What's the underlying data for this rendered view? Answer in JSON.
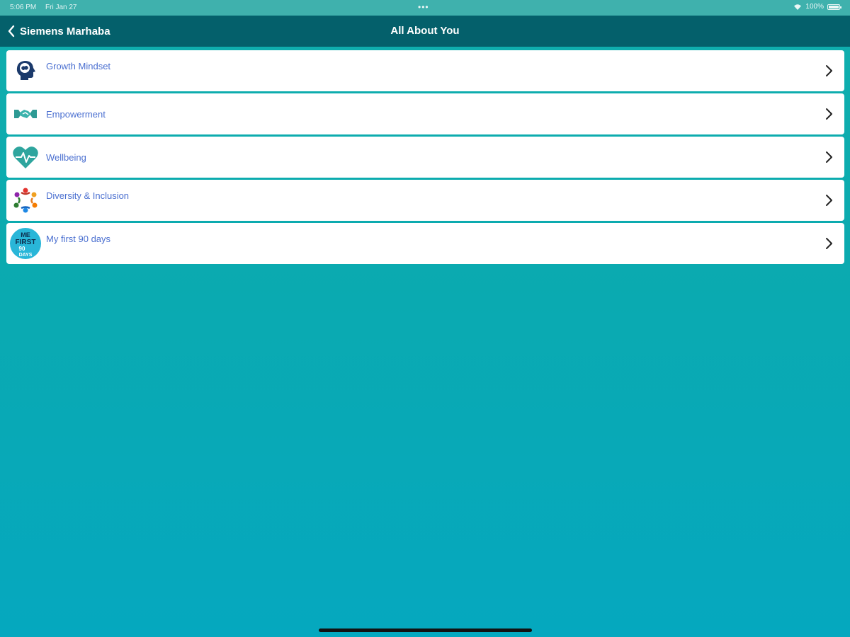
{
  "status_bar": {
    "time": "5:06 PM",
    "date": "Fri Jan 27",
    "dots": "•••",
    "battery": "100%"
  },
  "nav": {
    "back_label": "Siemens Marhaba",
    "title": "All About You"
  },
  "items": [
    {
      "label": "Growth Mindset",
      "icon": "brain-head-icon"
    },
    {
      "label": "Empowerment",
      "icon": "handshake-icon"
    },
    {
      "label": "Wellbeing",
      "icon": "heart-pulse-icon"
    },
    {
      "label": "Diversity & Inclusion",
      "icon": "diversity-circle-icon"
    },
    {
      "label": "My first 90 days",
      "icon": "me-first-badge-icon",
      "badge_text": [
        "ME",
        "FIRST",
        "90",
        "DAYS"
      ]
    }
  ],
  "colors": {
    "nav_bg": "#04606b",
    "label": "#4a6fd0",
    "background": "#0baaaf"
  }
}
